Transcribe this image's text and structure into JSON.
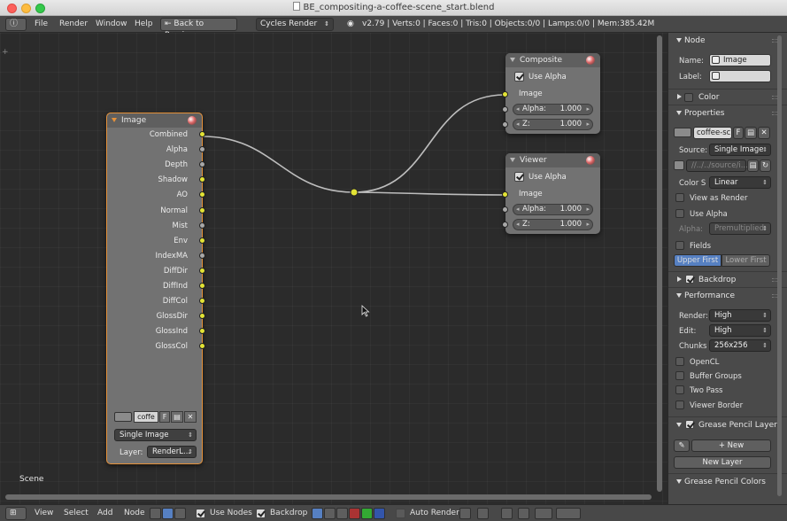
{
  "window": {
    "title": "BE_compositing-a-coffee-scene_start.blend"
  },
  "info_header": {
    "menus": [
      "File",
      "Render",
      "Window",
      "Help"
    ],
    "back_button": "Back to Previous",
    "render_engine": "Cycles Render",
    "stats": "v2.79 | Verts:0 | Faces:0 | Tris:0 | Objects:0/0 | Lamps:0/0 | Mem:385.42M"
  },
  "editor": {
    "scene_label": "Scene",
    "image_node": {
      "title": "Image",
      "outputs": [
        {
          "label": "Combined",
          "color": "yellow"
        },
        {
          "label": "Alpha",
          "color": "gray"
        },
        {
          "label": "Depth",
          "color": "gray"
        },
        {
          "label": "Shadow",
          "color": "yellow"
        },
        {
          "label": "AO",
          "color": "yellow"
        },
        {
          "label": "Normal",
          "color": "yellow"
        },
        {
          "label": "Mist",
          "color": "gray"
        },
        {
          "label": "Env",
          "color": "yellow"
        },
        {
          "label": "IndexMA",
          "color": "gray"
        },
        {
          "label": "DiffDir",
          "color": "yellow"
        },
        {
          "label": "DiffInd",
          "color": "yellow"
        },
        {
          "label": "DiffCol",
          "color": "yellow"
        },
        {
          "label": "GlossDir",
          "color": "yellow"
        },
        {
          "label": "GlossInd",
          "color": "yellow"
        },
        {
          "label": "GlossCol",
          "color": "yellow"
        }
      ],
      "image_name": "coffe",
      "fake_user": "F",
      "source": "Single Image",
      "layer_label": "Layer:",
      "layer_value": "RenderL..."
    },
    "composite_node": {
      "title": "Composite",
      "use_alpha": "Use Alpha",
      "image_label": "Image",
      "alpha_label": "Alpha:",
      "alpha_value": "1.000",
      "z_label": "Z:",
      "z_value": "1.000"
    },
    "viewer_node": {
      "title": "Viewer",
      "use_alpha": "Use Alpha",
      "image_label": "Image",
      "alpha_label": "Alpha:",
      "alpha_value": "1.000",
      "z_label": "Z:",
      "z_value": "1.000"
    }
  },
  "properties": {
    "node_header": "Node",
    "name_label": "Name:",
    "name_value": "Image",
    "label_label": "Label:",
    "label_value": "",
    "color_header": "Color",
    "properties_header": "Properties",
    "image_datablock": "coffee-sc",
    "fake_user": "F",
    "source_label": "Source:",
    "source_value": "Single Image",
    "filepath": "//../../source/i...",
    "color_space_label": "Color S",
    "color_space_value": "Linear",
    "view_as_render": "View as Render",
    "use_alpha": "Use Alpha",
    "alpha_label": "Alpha:",
    "alpha_value": "Premultiplied",
    "fields": "Fields",
    "upper_first": "Upper First",
    "lower_first": "Lower First",
    "backdrop_header": "Backdrop",
    "performance_header": "Performance",
    "render_label": "Render:",
    "render_value": "High",
    "edit_label": "Edit:",
    "edit_value": "High",
    "chunks_label": "Chunks",
    "chunks_value": "256x256",
    "opencl": "OpenCL",
    "buffer_groups": "Buffer Groups",
    "two_pass": "Two Pass",
    "viewer_border": "Viewer Border",
    "grease_layers_header": "Grease Pencil Layers",
    "new_button": "New",
    "new_layer_button": "New Layer",
    "grease_colors_header": "Grease Pencil Colors"
  },
  "bottom_bar": {
    "menus": [
      "View",
      "Select",
      "Add",
      "Node"
    ],
    "use_nodes": "Use Nodes",
    "backdrop": "Backdrop",
    "auto_render": "Auto Render"
  }
}
